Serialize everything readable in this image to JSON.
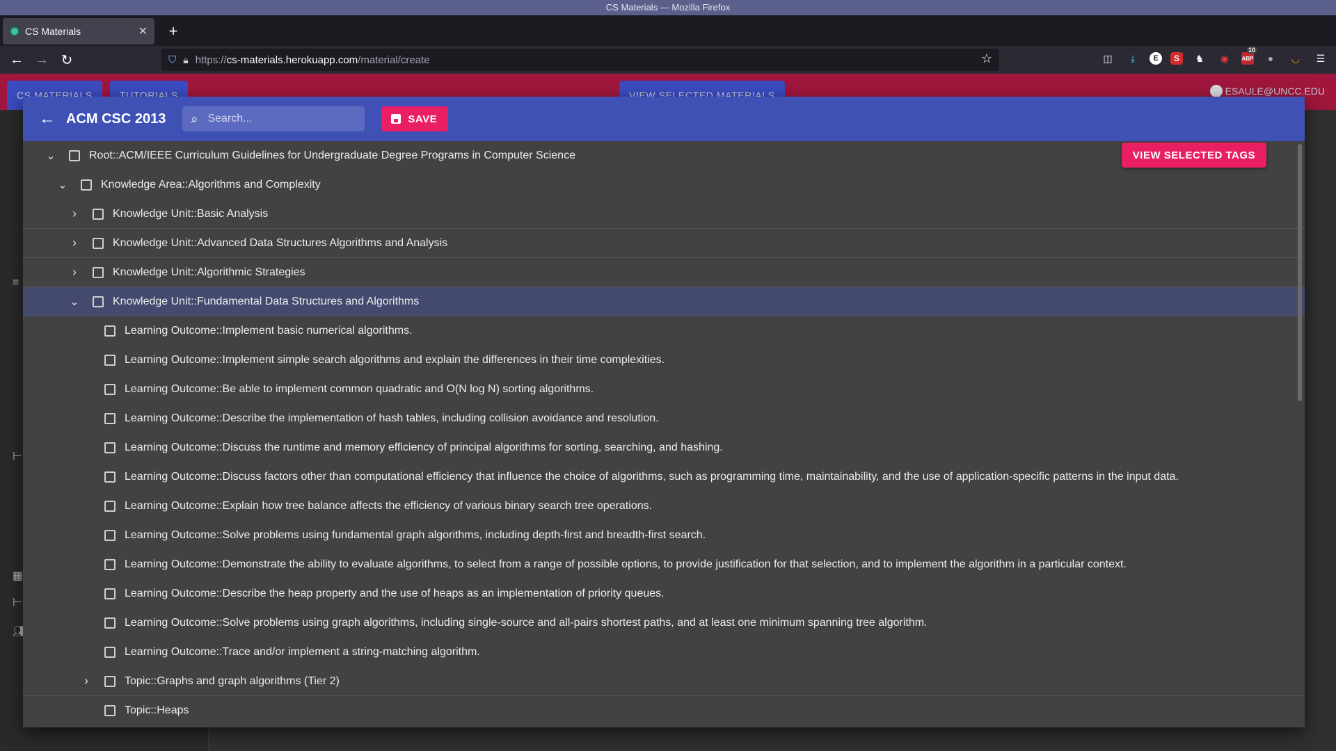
{
  "os": {
    "window_title": "CS Materials — Mozilla Firefox"
  },
  "browser": {
    "tab_title": "CS Materials",
    "url_prefix": "https://",
    "url_host": "cs-materials.herokuapp.com",
    "url_path": "/material/create",
    "toolbar_badges": {
      "downloads_count": "10"
    }
  },
  "site": {
    "tabs": [
      "CS MATERIALS",
      "TUTORIALS",
      "VIEW SELECTED MATERIALS"
    ],
    "user": "ESAULE@UNCC.EDU"
  },
  "dialog": {
    "title": "ACM CSC 2013",
    "search_placeholder": "Search...",
    "save_label": "SAVE",
    "view_tags_label": "VIEW SELECTED TAGS"
  },
  "tree": [
    {
      "depth": 0,
      "expanded": true,
      "label": "Root::ACM/IEEE Curriculum Guidelines for Undergraduate Degree Programs in Computer Science"
    },
    {
      "depth": 1,
      "expanded": true,
      "label": "Knowledge Area::Algorithms and Complexity"
    },
    {
      "depth": 2,
      "expanded": false,
      "label": "Knowledge Unit::Basic Analysis"
    },
    {
      "depth": 2,
      "expanded": false,
      "label": "Knowledge Unit::Advanced Data Structures Algorithms and Analysis"
    },
    {
      "depth": 2,
      "expanded": false,
      "label": "Knowledge Unit::Algorithmic Strategies"
    },
    {
      "depth": 2,
      "expanded": true,
      "label": "Knowledge Unit::Fundamental Data Structures and Algorithms",
      "active": true
    },
    {
      "depth": 3,
      "leaf": true,
      "label": "Learning Outcome::Implement basic numerical algorithms."
    },
    {
      "depth": 3,
      "leaf": true,
      "label": "Learning Outcome::Implement simple search algorithms and explain the differences in their time complexities."
    },
    {
      "depth": 3,
      "leaf": true,
      "label": "Learning Outcome::Be able to implement common quadratic and O(N log N) sorting algorithms."
    },
    {
      "depth": 3,
      "leaf": true,
      "label": "Learning Outcome::Describe the implementation of hash tables, including collision avoidance and resolution."
    },
    {
      "depth": 3,
      "leaf": true,
      "label": "Learning Outcome::Discuss the runtime and memory efficiency of principal algorithms for sorting, searching, and hashing."
    },
    {
      "depth": 3,
      "leaf": true,
      "label": "Learning Outcome::Discuss factors other than computational efficiency that influence the choice of algorithms, such as programming time, maintainability, and the use of application-specific patterns in the input data."
    },
    {
      "depth": 3,
      "leaf": true,
      "label": "Learning Outcome::Explain how tree balance affects the efficiency of various binary search tree operations."
    },
    {
      "depth": 3,
      "leaf": true,
      "label": "Learning Outcome::Solve problems using fundamental graph algorithms, including depth-first and breadth-first search."
    },
    {
      "depth": 3,
      "leaf": true,
      "label": "Learning Outcome::Demonstrate the ability to evaluate algorithms, to select from a range of possible options, to provide justification for that selection, and to implement the algorithm in a particular context."
    },
    {
      "depth": 3,
      "leaf": true,
      "label": "Learning Outcome::Describe the heap property and the use of heaps as an implementation of priority queues."
    },
    {
      "depth": 3,
      "leaf": true,
      "label": "Learning Outcome::Solve problems using graph algorithms, including single-source and all-pairs shortest paths, and at least one minimum spanning tree algorithm."
    },
    {
      "depth": 3,
      "leaf": true,
      "label": "Learning Outcome::Trace and/or implement a string-matching algorithm."
    },
    {
      "depth": 3,
      "expanded": false,
      "label": "Topic::Graphs and graph algorithms (Tier 2)"
    },
    {
      "depth": 3,
      "leaf": true,
      "label": "Topic::Heaps"
    }
  ]
}
